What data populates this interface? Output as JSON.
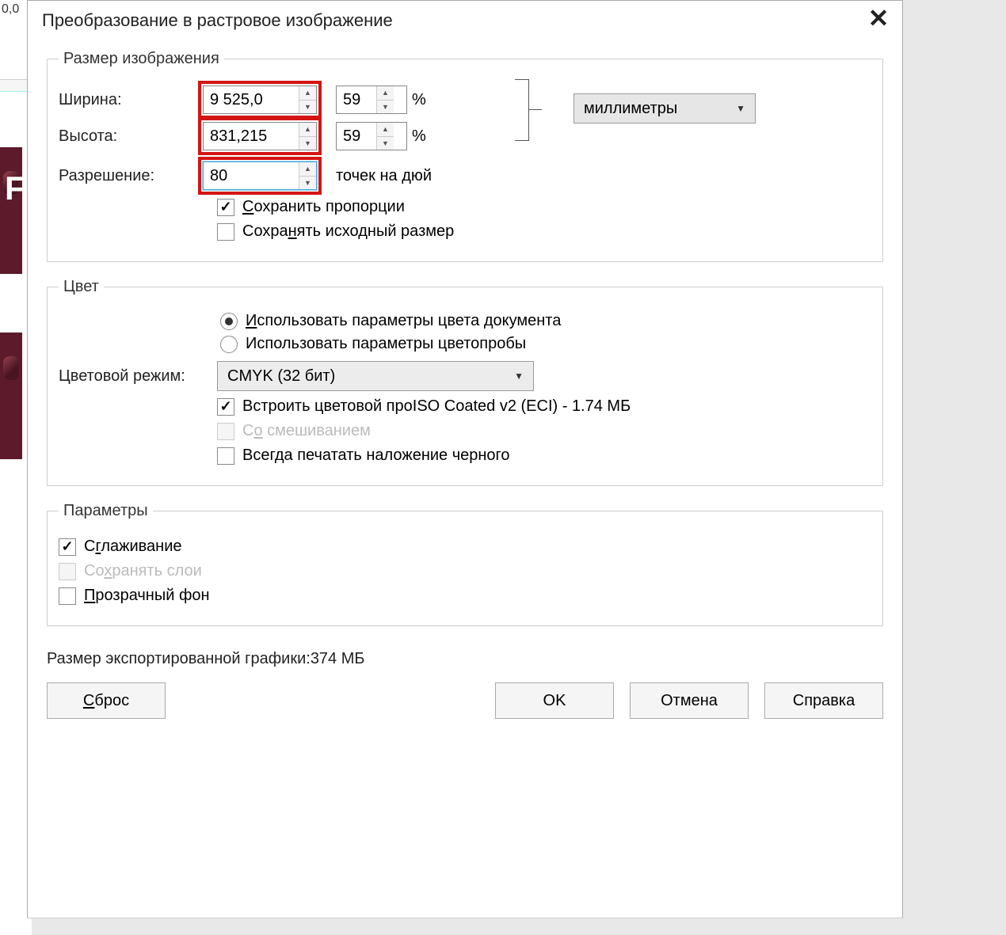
{
  "bg": {
    "ruler_num": "0,0",
    "letter": "F"
  },
  "dialog": {
    "title": "Преобразование в растровое изображение",
    "size_section": {
      "legend": "Размер изображения",
      "width_label": "Ширина:",
      "width_value": "9 525,0",
      "width_pct": "59",
      "height_label": "Высота:",
      "height_value": "831,215",
      "height_pct": "59",
      "pct_symbol": "%",
      "resolution_label": "Разрешение:",
      "resolution_value": "80",
      "resolution_unit": "точек на дюй",
      "units_label": "миллиметры",
      "keep_ratio": "Сохранить пропорции",
      "keep_source": "Сохранять исходный размер"
    },
    "color_section": {
      "legend": "Цвет",
      "use_doc": "Использовать параметры цвета документа",
      "use_proof": "Использовать параметры цветопробы",
      "mode_label": "Цветовой режим:",
      "mode_value": "CMYK (32 бит)",
      "embed_profile_prefix": "Встроить цветовой про",
      "embed_profile_suffix": "ISO Coated v2 (ECI) - 1.74 МБ",
      "dithering": "Со смешиванием",
      "black_overprint": "Всегда печатать наложение черного"
    },
    "params_section": {
      "legend": "Параметры",
      "antialias": "Сглаживание",
      "keep_layers": "Сохранять слои",
      "transparent_bg": "Прозрачный фон"
    },
    "footer": {
      "export_size_label": "Размер экспортированной графики: ",
      "export_size_value": "374 МБ"
    },
    "buttons": {
      "reset": "Сброс",
      "ok": "OK",
      "cancel": "Отмена",
      "help": "Справка"
    }
  }
}
